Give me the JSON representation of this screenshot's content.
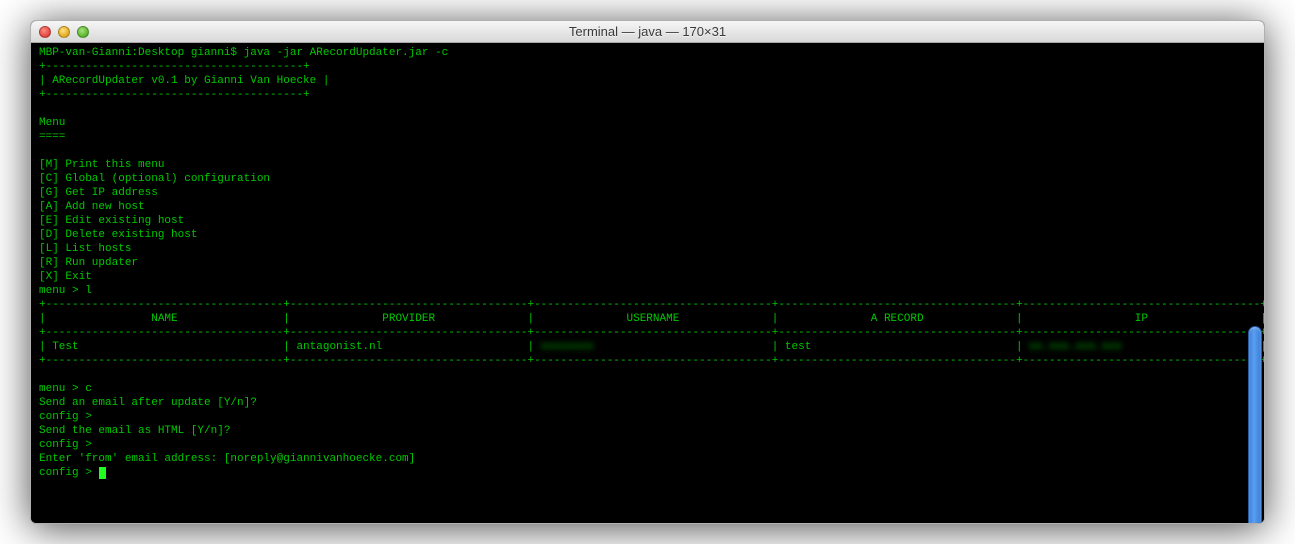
{
  "window": {
    "title": "Terminal — java — 170×31"
  },
  "term": {
    "prompt_line": "MBP-van-Gianni:Desktop gianni$ java -jar ARecordUpdater.jar -c",
    "box_top": "+---------------------------------------+",
    "box_mid": "| ARecordUpdater v0.1 by Gianni Van Hoecke |",
    "box_bot": "+---------------------------------------+",
    "menu_hdr": "Menu",
    "menu_eq": "====",
    "menu_items": [
      "[M] Print this menu",
      "[C] Global (optional) configuration",
      "[G] Get IP address",
      "[A] Add new host",
      "[E] Edit existing host",
      "[D] Delete existing host",
      "[L] List hosts",
      "[R] Run updater",
      "[X] Exit"
    ],
    "menu_prompt_l": "menu > l",
    "table": {
      "sep": "+------------------------------------+------------------------------------+------------------------------------+------------------------------------+------------------------------------+",
      "header": "|                NAME                |              PROVIDER              |              USERNAME              |              A RECORD              |                 IP                 |",
      "row_name": "Test",
      "row_provider": "antagonist.nl",
      "row_username_blur": "xxxxxxxx",
      "row_arecord": "test",
      "row_ip_blur": "xx.xxx.xxx.xxx"
    },
    "menu_prompt_c": "menu > c",
    "q1": "Send an email after update [Y/n]?",
    "cfg1": "config >",
    "q2": "Send the email as HTML [Y/n]?",
    "cfg2": "config >",
    "q3": "Enter 'from' email address: [noreply@giannivanhoecke.com]",
    "cfg3": "config > "
  }
}
